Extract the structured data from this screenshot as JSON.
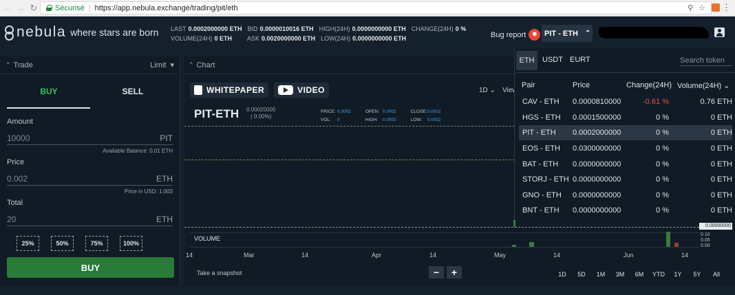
{
  "browser": {
    "secure_label": "Sécurisé",
    "url": "https://app.nebula.exchange/trading/pit/eth"
  },
  "header": {
    "brand": "nebula",
    "tagline": "where stars are born",
    "stats": {
      "last_label": "LAST",
      "last": "0.0002000000 ETH",
      "bid_label": "BID",
      "bid": "0.0000010016 ETH",
      "high_label": "HIGH(24H)",
      "high": "0.0000000000 ETH",
      "change_label": "CHANGE(24H)",
      "change": "0 %",
      "volume_label": "VOLUME(24H)",
      "volume": "0 ETH",
      "ask_label": "ASK",
      "ask": "0.0020000000 ETH",
      "low_label": "LOW(24H)",
      "low": "0.0000000000 ETH"
    },
    "bug_report": "Bug report",
    "pair": "PIT - ETH"
  },
  "trade": {
    "title": "Trade",
    "order_type": "Limit",
    "tab_buy": "BUY",
    "tab_sell": "SELL",
    "amount_label": "Amount",
    "amount_value": "10000",
    "amount_unit": "PIT",
    "available_balance": "Available Balance: 0.01 ETH",
    "price_label": "Price",
    "price_value": "0.002",
    "price_unit": "ETH",
    "price_usd": "Price in USD: 1.003",
    "total_label": "Total",
    "total_value": "20",
    "total_unit": "ETH",
    "percents": [
      "25%",
      "50%",
      "75%",
      "100%"
    ],
    "submit": "BUY"
  },
  "chart": {
    "title": "Chart",
    "whitepaper": "WHITEPAPER",
    "video": "VIDEO",
    "interval": "1D",
    "view": "View",
    "symbol": "PIT-ETH",
    "symbol_price": "0.00020000",
    "symbol_change": "( 0.00%)",
    "ohlc": {
      "price_label": "PRICE:",
      "price": "0.0002",
      "open_label": "OPEN:",
      "open": "0.0002",
      "close_label": "CLOSE:",
      "close": "0.0002",
      "vol_label": "VOL:",
      "vol": "0",
      "high_label": "HIGH:",
      "high": "0.0002",
      "low_label": "LOW:",
      "low": "0.0002"
    },
    "volume_label": "VOLUME",
    "price_tag": "0.00000000",
    "volume_axis": [
      "0.10",
      "0.05",
      "0.00"
    ],
    "x_ticks": [
      "14",
      "Mar",
      "14",
      "Apr",
      "14",
      "May",
      "14",
      "Jun",
      "14"
    ],
    "snapshot": "Take a snapshot",
    "zoom_out": "−",
    "zoom_in": "+",
    "ranges": [
      "1D",
      "5D",
      "1M",
      "3M",
      "6M",
      "YTD",
      "1Y",
      "5Y",
      "All"
    ]
  },
  "pairs": {
    "tabs": [
      "ETH",
      "USDT",
      "EURT"
    ],
    "search_placeholder": "Search token",
    "headers": {
      "pair": "Pair",
      "price": "Price",
      "change": "Change(24H)",
      "volume": "Volume(24H)"
    },
    "rows": [
      {
        "pair": "CAV - ETH",
        "price": "0.0000810000",
        "change": "-0.61 %",
        "volume": "0.76 ETH"
      },
      {
        "pair": "HGS - ETH",
        "price": "0.0001500000",
        "change": "0 %",
        "volume": "0 ETH"
      },
      {
        "pair": "PIT - ETH",
        "price": "0.0002000000",
        "change": "0 %",
        "volume": "0 ETH"
      },
      {
        "pair": "EOS - ETH",
        "price": "0.0300000000",
        "change": "0 %",
        "volume": "0 ETH"
      },
      {
        "pair": "BAT - ETH",
        "price": "0.0000000000",
        "change": "0 %",
        "volume": "0 ETH"
      },
      {
        "pair": "STORJ - ETH",
        "price": "0.0000000000",
        "change": "0 %",
        "volume": "0 ETH"
      },
      {
        "pair": "GNO - ETH",
        "price": "0.0000000000",
        "change": "0 %",
        "volume": "0 ETH"
      },
      {
        "pair": "BNT - ETH",
        "price": "0.0000000000",
        "change": "0 %",
        "volume": "0 ETH"
      }
    ]
  }
}
